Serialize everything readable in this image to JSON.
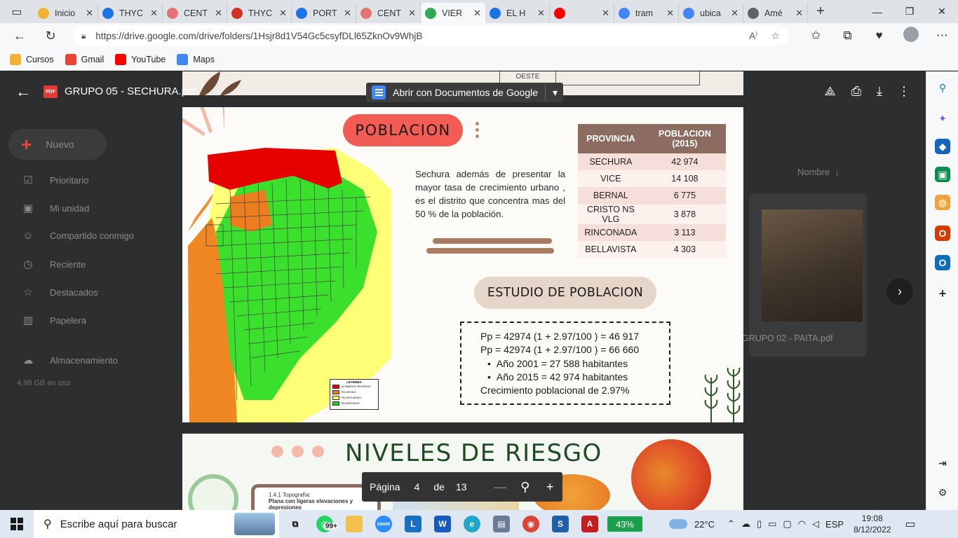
{
  "browser": {
    "tabs": [
      {
        "label": "Inicio",
        "color": "#f2b134"
      },
      {
        "label": "THYC",
        "color": "#1a73e8"
      },
      {
        "label": "CENT",
        "color": "#e57373"
      },
      {
        "label": "THYC",
        "color": "#d93025"
      },
      {
        "label": "PORT",
        "color": "#1a73e8"
      },
      {
        "label": "CENT",
        "color": "#e57373"
      },
      {
        "label": "VIER",
        "color": "#34a853"
      },
      {
        "label": "EL H",
        "color": "#1a73e8"
      },
      {
        "label": "",
        "color": "#ff0000"
      },
      {
        "label": "tram",
        "color": "#4285f4"
      },
      {
        "label": "ubica",
        "color": "#4285f4"
      },
      {
        "label": "Amé",
        "color": "#5f6368"
      }
    ],
    "active_tab_index": 6,
    "url": "https://drive.google.com/drive/folders/1Hsjr8d1V54Gc5csyfDLl65ZknOv9WhjB",
    "bookmarks": [
      {
        "label": "Cursos",
        "icon": "folder-icon",
        "color": "#f2b134"
      },
      {
        "label": "Gmail",
        "icon": "gmail-icon",
        "color": "#ea4335"
      },
      {
        "label": "YouTube",
        "icon": "youtube-icon",
        "color": "#ff0000"
      },
      {
        "label": "Maps",
        "icon": "google-icon",
        "color": "#4285f4"
      }
    ]
  },
  "drive": {
    "file_title": "GRUPO 05 - SECHURA.pdf",
    "open_with_label": "Abrir con Documentos de Google",
    "new_button": "Nuevo",
    "nav_items": [
      {
        "label": "Prioritario",
        "icon": "check-icon"
      },
      {
        "label": "Mi unidad",
        "icon": "drive-icon"
      },
      {
        "label": "Compartido conmigo",
        "icon": "people-icon"
      },
      {
        "label": "Reciente",
        "icon": "clock-icon"
      },
      {
        "label": "Destacados",
        "icon": "star-icon"
      },
      {
        "label": "Papelera",
        "icon": "trash-icon"
      },
      {
        "label": "Almacenamiento",
        "icon": "cloud-icon"
      }
    ],
    "storage_used": "4,98 GB en uso",
    "sort_label": "Nombre",
    "side_file_name": "GRUPO 02 - PAITA.pdf",
    "pager": {
      "label": "Página",
      "current": "4",
      "of": "de",
      "total": "13"
    }
  },
  "prev_page": {
    "cell_text": "OESTE"
  },
  "page": {
    "title": "POBLACION",
    "description": "Sechura además de presentar la mayor tasa de crecimiento urbano , es el distrito  que concentra mas del 50 % de la población.",
    "table": {
      "headers": [
        "PROVINCIA",
        "POBLACION (2015)"
      ],
      "rows": [
        [
          "SECHURA",
          "42 974"
        ],
        [
          "VICE",
          "14 108"
        ],
        [
          "BERNAL",
          "6 775"
        ],
        [
          "CRISTO NS VLG",
          "3 878"
        ],
        [
          "RINCONADA",
          "3 113"
        ],
        [
          "BELLAVISTA",
          "4 303"
        ]
      ]
    },
    "subtitle": "ESTUDIO DE POBLACION",
    "formulas": [
      "Pp = 42974 (1 + 2.97/100 ) = 46 917",
      "Pp = 42974 (1 + 2.97/100 ) = 66 660"
    ],
    "bullets": [
      "Año 2001 = 27 588 habitantes",
      "Año 2015 = 42 974 habitantes"
    ],
    "growth": "Crecimiento poblacional de 2.97%",
    "legend": {
      "title": "LEYENDA",
      "items": [
        {
          "label": "ALTAMENTE PELIGROSO",
          "color": "#e60000"
        },
        {
          "label": "PELIGROSO",
          "color": "#ee7d1f"
        },
        {
          "label": "PELIGRO MEDIO",
          "color": "#ffff66"
        },
        {
          "label": "PELIGRO BAJO",
          "color": "#22d11a"
        }
      ]
    }
  },
  "next_page": {
    "title": "NIVELES DE RIESGO",
    "topo_label": "1.4.1 Topografía:",
    "topo_value": "Plana con ligeras elevaciones y depresiones"
  },
  "taskbar": {
    "search_placeholder": "Escribe aquí para buscar",
    "badge": "99+",
    "battery": "43%",
    "temperature": "22°C",
    "language": "ESP",
    "time": "19:08",
    "date": "8/12/2022"
  }
}
